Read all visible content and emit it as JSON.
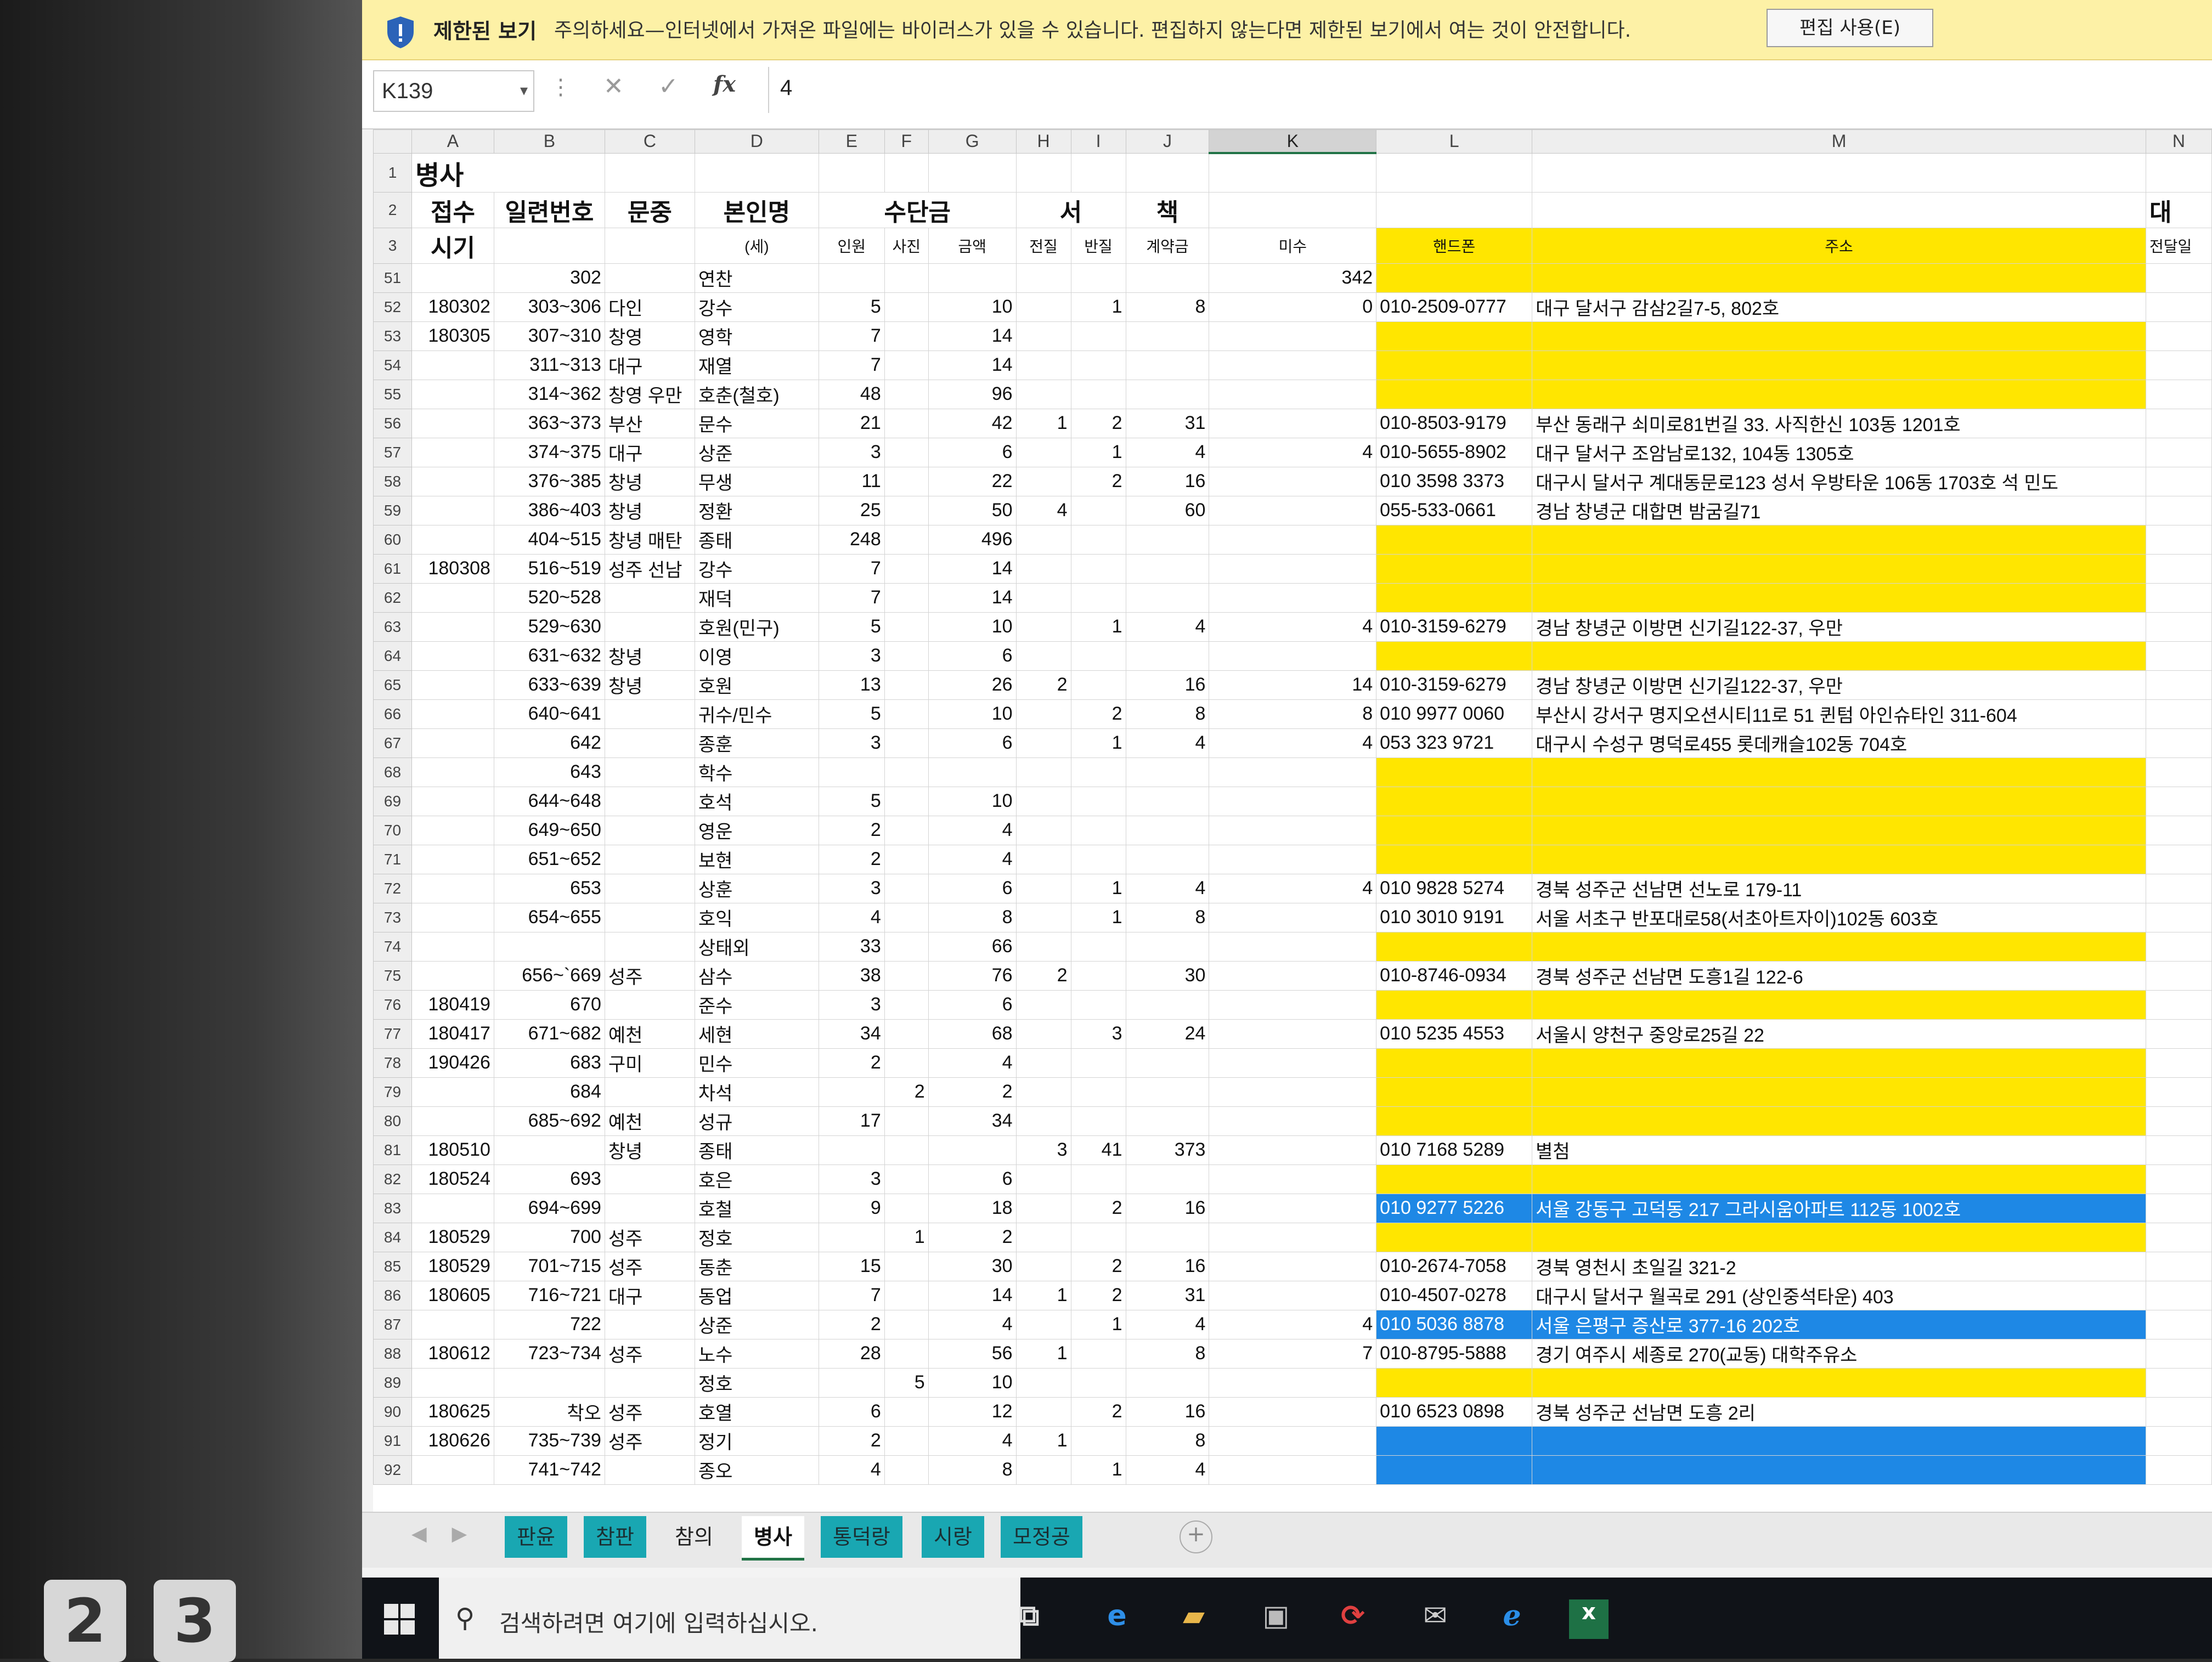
{
  "protected_view": {
    "title": "제한된 보기",
    "message": "주의하세요—인터넷에서 가져온 파일에는 바이러스가 있을 수 있습니다. 편집하지 않는다면 제한된 보기에서 여는 것이 안전합니다.",
    "enable_button": "편집 사용(E)"
  },
  "formula_bar": {
    "name_box": "K139",
    "dots": "⋮",
    "cancel_icon": "✕",
    "enter_icon": "✓",
    "fx_label": "fx",
    "value": "4"
  },
  "columns": [
    "",
    "A",
    "B",
    "C",
    "D",
    "E",
    "F",
    "G",
    "H",
    "I",
    "J",
    "K",
    "L",
    "M",
    "N"
  ],
  "header_rows": {
    "r1": {
      "num": "1",
      "A": "병사"
    },
    "r2": {
      "num": "2",
      "A": "접수",
      "B": "일련번호",
      "C": "문중",
      "D": "본인명",
      "EG": "수단금",
      "HI": "서",
      "J": "책",
      "N": "대"
    },
    "r3": {
      "num": "3",
      "A": "시기",
      "D": "(세)",
      "E": "인원",
      "F": "사진",
      "G": "금액",
      "H": "전질",
      "I": "반질",
      "J": "계약금",
      "K": "미수",
      "L": "핸드폰",
      "M": "주소",
      "N": "전달일"
    }
  },
  "rows": [
    {
      "num": "51",
      "A": "",
      "B": "302",
      "C": "",
      "D": "연찬",
      "E": "",
      "F": "",
      "G": "",
      "H": "",
      "I": "",
      "J": "",
      "K": "342",
      "L": "",
      "M": "",
      "y": 1
    },
    {
      "num": "52",
      "A": "180302",
      "B": "303~306",
      "C": "다인",
      "D": "강수",
      "E": "5",
      "F": "",
      "G": "10",
      "H": "",
      "I": "1",
      "J": "8",
      "K": "0",
      "L": "010-2509-0777",
      "M": "대구 달서구 감삼2길7-5, 802호",
      "y": 0
    },
    {
      "num": "53",
      "A": "180305",
      "B": "307~310",
      "C": "창영",
      "D": "영학",
      "E": "7",
      "F": "",
      "G": "14",
      "H": "",
      "I": "",
      "J": "",
      "K": "",
      "L": "",
      "M": "",
      "y": 1
    },
    {
      "num": "54",
      "A": "",
      "B": "311~313",
      "C": "대구",
      "D": "재열",
      "E": "7",
      "F": "",
      "G": "14",
      "H": "",
      "I": "",
      "J": "",
      "K": "",
      "L": "",
      "M": "",
      "y": 1
    },
    {
      "num": "55",
      "A": "",
      "B": "314~362",
      "C": "창영 우만",
      "D": "호춘(철호)",
      "E": "48",
      "F": "",
      "G": "96",
      "H": "",
      "I": "",
      "J": "",
      "K": "",
      "L": "",
      "M": "",
      "y": 1
    },
    {
      "num": "56",
      "A": "",
      "B": "363~373",
      "C": "부산",
      "D": "문수",
      "E": "21",
      "F": "",
      "G": "42",
      "H": "1",
      "I": "2",
      "J": "31",
      "K": "",
      "L": "010-8503-9179",
      "M": "부산 동래구 쇠미로81번길 33. 사직한신 103동 1201호",
      "y": 0
    },
    {
      "num": "57",
      "A": "",
      "B": "374~375",
      "C": "대구",
      "D": "상준",
      "E": "3",
      "F": "",
      "G": "6",
      "H": "",
      "I": "1",
      "J": "4",
      "K": "4",
      "L": "010-5655-8902",
      "M": "대구 달서구 조암남로132, 104동 1305호",
      "y": 0
    },
    {
      "num": "58",
      "A": "",
      "B": "376~385",
      "C": "창녕",
      "D": "무생",
      "E": "11",
      "F": "",
      "G": "22",
      "H": "",
      "I": "2",
      "J": "16",
      "K": "",
      "L": "010 3598 3373",
      "M": "대구시 달서구 계대동문로123 성서 우방타운 106동 1703호 석 민도",
      "y": 0
    },
    {
      "num": "59",
      "A": "",
      "B": "386~403",
      "C": "창녕",
      "D": "정환",
      "E": "25",
      "F": "",
      "G": "50",
      "H": "4",
      "I": "",
      "J": "60",
      "K": "",
      "L": "055-533-0661",
      "M": "경남 창녕군 대합면 밤굼길71",
      "y": 0
    },
    {
      "num": "60",
      "A": "",
      "B": "404~515",
      "C": "창녕 매탄",
      "D": "종태",
      "E": "248",
      "F": "",
      "G": "496",
      "H": "",
      "I": "",
      "J": "",
      "K": "",
      "L": "",
      "M": "",
      "y": 1
    },
    {
      "num": "61",
      "A": "180308",
      "B": "516~519",
      "C": "성주 선남",
      "D": "강수",
      "E": "7",
      "F": "",
      "G": "14",
      "H": "",
      "I": "",
      "J": "",
      "K": "",
      "L": "",
      "M": "",
      "y": 1
    },
    {
      "num": "62",
      "A": "",
      "B": "520~528",
      "C": "",
      "D": "재덕",
      "E": "7",
      "F": "",
      "G": "14",
      "H": "",
      "I": "",
      "J": "",
      "K": "",
      "L": "",
      "M": "",
      "y": 1
    },
    {
      "num": "63",
      "A": "",
      "B": "529~630",
      "C": "",
      "D": "호원(민구)",
      "E": "5",
      "F": "",
      "G": "10",
      "H": "",
      "I": "1",
      "J": "4",
      "K": "4",
      "L": "010-3159-6279",
      "M": "경남 창녕군 이방면 신기길122-37, 우만",
      "y": 0
    },
    {
      "num": "64",
      "A": "",
      "B": "631~632",
      "C": "창녕",
      "D": "이영",
      "E": "3",
      "F": "",
      "G": "6",
      "H": "",
      "I": "",
      "J": "",
      "K": "",
      "L": "",
      "M": "",
      "y": 1
    },
    {
      "num": "65",
      "A": "",
      "B": "633~639",
      "C": "창녕",
      "D": "호원",
      "E": "13",
      "F": "",
      "G": "26",
      "H": "2",
      "I": "",
      "J": "16",
      "K": "14",
      "L": "010-3159-6279",
      "M": "경남 창녕군 이방면 신기길122-37, 우만",
      "y": 0
    },
    {
      "num": "66",
      "A": "",
      "B": "640~641",
      "C": "",
      "D": "귀수/민수",
      "E": "5",
      "F": "",
      "G": "10",
      "H": "",
      "I": "2",
      "J": "8",
      "K": "8",
      "L": "010 9977 0060",
      "M": "부산시 강서구 명지오션시티11로 51 퀸텀 아인슈타인 311-604",
      "y": 0
    },
    {
      "num": "67",
      "A": "",
      "B": "642",
      "C": "",
      "D": "종훈",
      "E": "3",
      "F": "",
      "G": "6",
      "H": "",
      "I": "1",
      "J": "4",
      "K": "4",
      "L": "053 323 9721",
      "M": "대구시 수성구 명덕로455 롯데캐슬102동 704호",
      "y": 0
    },
    {
      "num": "68",
      "A": "",
      "B": "643",
      "C": "",
      "D": "학수",
      "E": "",
      "F": "",
      "G": "",
      "H": "",
      "I": "",
      "J": "",
      "K": "",
      "L": "",
      "M": "",
      "y": 1
    },
    {
      "num": "69",
      "A": "",
      "B": "644~648",
      "C": "",
      "D": "호석",
      "E": "5",
      "F": "",
      "G": "10",
      "H": "",
      "I": "",
      "J": "",
      "K": "",
      "L": "",
      "M": "",
      "y": 1
    },
    {
      "num": "70",
      "A": "",
      "B": "649~650",
      "C": "",
      "D": "영운",
      "E": "2",
      "F": "",
      "G": "4",
      "H": "",
      "I": "",
      "J": "",
      "K": "",
      "L": "",
      "M": "",
      "y": 1
    },
    {
      "num": "71",
      "A": "",
      "B": "651~652",
      "C": "",
      "D": "보현",
      "E": "2",
      "F": "",
      "G": "4",
      "H": "",
      "I": "",
      "J": "",
      "K": "",
      "L": "",
      "M": "",
      "y": 1
    },
    {
      "num": "72",
      "A": "",
      "B": "653",
      "C": "",
      "D": "상훈",
      "E": "3",
      "F": "",
      "G": "6",
      "H": "",
      "I": "1",
      "J": "4",
      "K": "4",
      "L": "010 9828 5274",
      "M": "경북 성주군 선남면 선노로 179-11",
      "y": 0
    },
    {
      "num": "73",
      "A": "",
      "B": "654~655",
      "C": "",
      "D": "호익",
      "E": "4",
      "F": "",
      "G": "8",
      "H": "",
      "I": "1",
      "J": "8",
      "K": "",
      "L": "010 3010 9191",
      "M": "서울 서초구 반포대로58(서초아트자이)102동 603호",
      "y": 0
    },
    {
      "num": "74",
      "A": "",
      "B": "",
      "C": "",
      "D": "상태외",
      "E": "33",
      "F": "",
      "G": "66",
      "H": "",
      "I": "",
      "J": "",
      "K": "",
      "L": "",
      "M": "",
      "y": 1
    },
    {
      "num": "75",
      "A": "",
      "B": "656~`669",
      "C": "성주",
      "D": "삼수",
      "E": "38",
      "F": "",
      "G": "76",
      "H": "2",
      "I": "",
      "J": "30",
      "K": "",
      "L": "010-8746-0934",
      "M": "경북 성주군 선남면 도흥1길 122-6",
      "y": 0
    },
    {
      "num": "76",
      "A": "180419",
      "B": "670",
      "C": "",
      "D": "준수",
      "E": "3",
      "F": "",
      "G": "6",
      "H": "",
      "I": "",
      "J": "",
      "K": "",
      "L": "",
      "M": "",
      "y": 1
    },
    {
      "num": "77",
      "A": "180417",
      "B": "671~682",
      "C": "예천",
      "D": "세현",
      "E": "34",
      "F": "",
      "G": "68",
      "H": "",
      "I": "3",
      "J": "24",
      "K": "",
      "L": "010 5235 4553",
      "M": "서울시 양천구 중앙로25길 22",
      "y": 0
    },
    {
      "num": "78",
      "A": "190426",
      "B": "683",
      "C": "구미",
      "D": "민수",
      "E": "2",
      "F": "",
      "G": "4",
      "H": "",
      "I": "",
      "J": "",
      "K": "",
      "L": "",
      "M": "",
      "y": 1
    },
    {
      "num": "79",
      "A": "",
      "B": "684",
      "C": "",
      "D": "차석",
      "E": "",
      "F": "2",
      "G": "2",
      "H": "",
      "I": "",
      "J": "",
      "K": "",
      "L": "",
      "M": "",
      "y": 1
    },
    {
      "num": "80",
      "A": "",
      "B": "685~692",
      "C": "예천",
      "D": "성규",
      "E": "17",
      "F": "",
      "G": "34",
      "H": "",
      "I": "",
      "J": "",
      "K": "",
      "L": "",
      "M": "",
      "y": 1
    },
    {
      "num": "81",
      "A": "180510",
      "B": "",
      "C": "창녕",
      "D": "종태",
      "E": "",
      "F": "",
      "G": "",
      "H": "3",
      "I": "41",
      "J": "373",
      "K": "",
      "L": "010 7168 5289",
      "M": "별첨",
      "y": 0
    },
    {
      "num": "82",
      "A": "180524",
      "B": "693",
      "C": "",
      "D": "호은",
      "E": "3",
      "F": "",
      "G": "6",
      "H": "",
      "I": "",
      "J": "",
      "K": "",
      "L": "",
      "M": "",
      "y": 1
    },
    {
      "num": "83",
      "A": "",
      "B": "694~699",
      "C": "",
      "D": "호철",
      "E": "9",
      "F": "",
      "G": "18",
      "H": "",
      "I": "2",
      "J": "16",
      "K": "",
      "L": "010 9277 5226",
      "M": "서울 강동구 고덕동 217 그라시움아파트 112동 1002호",
      "y": 2
    },
    {
      "num": "84",
      "A": "180529",
      "B": "700",
      "C": "성주",
      "D": "정호",
      "E": "",
      "F": "1",
      "G": "2",
      "H": "",
      "I": "",
      "J": "",
      "K": "",
      "L": "",
      "M": "",
      "y": 1
    },
    {
      "num": "85",
      "A": "180529",
      "B": "701~715",
      "C": "성주",
      "D": "동춘",
      "E": "15",
      "F": "",
      "G": "30",
      "H": "",
      "I": "2",
      "J": "16",
      "K": "",
      "L": "010-2674-7058",
      "M": "경북 영천시 초일길 321-2",
      "y": 0
    },
    {
      "num": "86",
      "A": "180605",
      "B": "716~721",
      "C": "대구",
      "D": "동업",
      "E": "7",
      "F": "",
      "G": "14",
      "H": "1",
      "I": "2",
      "J": "31",
      "K": "",
      "L": "010-4507-0278",
      "M": "대구시 달서구 월곡로 291 (상인중석타운) 403",
      "y": 0
    },
    {
      "num": "87",
      "A": "",
      "B": "722",
      "C": "",
      "D": "상준",
      "E": "2",
      "F": "",
      "G": "4",
      "H": "",
      "I": "1",
      "J": "4",
      "K": "4",
      "L": "010 5036 8878",
      "M": "서울 은평구 증산로 377-16 202호",
      "y": 2
    },
    {
      "num": "88",
      "A": "180612",
      "B": "723~734",
      "C": "성주",
      "D": "노수",
      "E": "28",
      "F": "",
      "G": "56",
      "H": "1",
      "I": "",
      "J": "8",
      "K": "7",
      "L": "010-8795-5888",
      "M": "경기 여주시 세종로 270(교동) 대학주유소",
      "y": 0
    },
    {
      "num": "89",
      "A": "",
      "B": "",
      "C": "",
      "D": "정호",
      "E": "",
      "F": "5",
      "G": "10",
      "H": "",
      "I": "",
      "J": "",
      "K": "",
      "L": "",
      "M": "",
      "y": 1
    },
    {
      "num": "90",
      "A": "180625",
      "B": "착오",
      "C": "성주",
      "D": "호열",
      "E": "6",
      "F": "",
      "G": "12",
      "H": "",
      "I": "2",
      "J": "16",
      "K": "",
      "L": "010 6523 0898",
      "M": "경북 성주군 선남면 도흥 2리",
      "y": 0
    },
    {
      "num": "91",
      "A": "180626",
      "B": "735~739",
      "C": "성주",
      "D": "정기",
      "E": "2",
      "F": "",
      "G": "4",
      "H": "1",
      "I": "",
      "J": "8",
      "K": "",
      "L": "",
      "M": "",
      "y": 2
    },
    {
      "num": "92",
      "A": "",
      "B": "741~742",
      "C": "",
      "D": "종오",
      "E": "4",
      "F": "",
      "G": "8",
      "H": "",
      "I": "1",
      "J": "4",
      "K": "",
      "L": "",
      "M": "",
      "y": 2
    }
  ],
  "sheet_tabs": {
    "nav_prev": "◀",
    "nav_next": "▶",
    "tabs": [
      {
        "label": "판윤",
        "style": "teal"
      },
      {
        "label": "참판",
        "style": "teal"
      },
      {
        "label": "참의",
        "style": "plain"
      },
      {
        "label": "병사",
        "style": "active"
      },
      {
        "label": "통덕랑",
        "style": "teal"
      },
      {
        "label": "시랑",
        "style": "teal"
      },
      {
        "label": "모정공",
        "style": "teal"
      }
    ],
    "add": "+"
  },
  "taskbar": {
    "search_placeholder": "검색하려면 여기에 입력하십시오."
  },
  "keyboard": {
    "k1": "2",
    "k2": "3"
  },
  "colors": {
    "yellow": "#ffe600",
    "blue": "#1e88e5",
    "excel_green": "#217346",
    "tab_teal": "#19a7b2"
  }
}
